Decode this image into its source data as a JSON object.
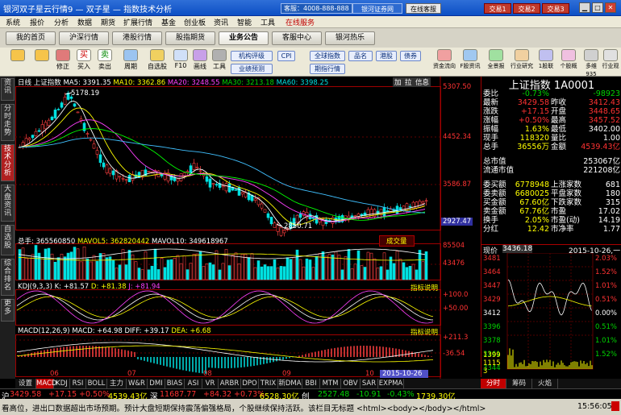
{
  "titlebar": {
    "app_title": "银河双子星云行情9 — 双子星 — 指数技术分析",
    "hotline": "客服：4008-888-888",
    "site_button": "银河证券网",
    "service_button": "在线客服",
    "trade_buttons": [
      "交易1",
      "交易2",
      "交易3"
    ]
  },
  "menu": [
    "系统",
    "报价",
    "分析",
    "数据",
    "期货",
    "扩展行情",
    "基金",
    "创业板",
    "资讯",
    "智能",
    "工具",
    "在线服务"
  ],
  "nav_tabs": [
    "我的首页",
    "沪深行情",
    "港股行情",
    "股指期货",
    "业务公告",
    "客服中心",
    "银河热乐"
  ],
  "toolbar": {
    "buttons": [
      "",
      "",
      "修正",
      "买入",
      "卖出",
      "周期",
      "自选股",
      "F10",
      "画线",
      "工具"
    ],
    "pills": [
      "机构评级",
      "业绩预测",
      "全球指数",
      "期指行情",
      "品名",
      "港股",
      "债券",
      "CPI"
    ],
    "right_buttons": [
      "资金流向",
      "F股资讯",
      "全景报",
      "行业研究",
      "1股联",
      "个股概",
      "多维935",
      "行业观"
    ]
  },
  "side_tabs": [
    "资讯",
    "分时走势",
    "技术分析",
    "大盘资讯",
    "自选股",
    "综合排名",
    "更多"
  ],
  "main_chart": {
    "price_header": [
      "日线",
      "上证指数",
      "MA5: 3391.35",
      "MA10: 3362.86",
      "MA20: 3248.55",
      "MA30: 3213.18",
      "MA60: 3398.25"
    ],
    "header_buttons": [
      "加",
      "拉",
      "信息"
    ],
    "high_label": "5178.19",
    "low_label": "2850.71",
    "price_axis": [
      "5307.50",
      "4452.34",
      "3586.87",
      "2927.47"
    ],
    "vol_header": [
      "总手: 365560850",
      "MAVOL5: 362820442",
      "MAVOL10: 349618967"
    ],
    "vol_button": "成交量",
    "vol_axis": [
      "85504",
      "43476"
    ],
    "kdj_header": [
      "KDJ(9,3,3)",
      "K: +81.57",
      "D: +81.38",
      "J: +81.94"
    ],
    "kdj_button": "指标说明",
    "kdj_axis": [
      "+100.0",
      "+50.00"
    ],
    "macd_header": [
      "MACD(12,26,9)",
      "MACD: +64.98",
      "DIFF: +39.17",
      "DEA: +6.68"
    ],
    "macd_button": "指标说明",
    "macd_axis": [
      "+211.3",
      "-36.54"
    ],
    "x_axis": [
      "06",
      "07",
      "08",
      "09",
      "10"
    ],
    "x_cursor_date": "2015-10-26"
  },
  "chart_data": {
    "type": "line",
    "title": "上证指数 日线",
    "x": [
      "06",
      "07",
      "08",
      "09",
      "10"
    ],
    "series": [
      {
        "name": "上证指数",
        "values": [
          4800,
          5178.19,
          3800,
          3950,
          3700,
          3200,
          2850.71,
          3100,
          3050,
          3250,
          3412.43
        ]
      }
    ],
    "ylim": [
      2927.47,
      5307.5
    ]
  },
  "right_panel": {
    "title": "上证指数 1A0001",
    "rows": [
      {
        "l1": "委比",
        "v1": "-0.73%",
        "l2": "",
        "v2": "-98923"
      },
      {
        "l1": "最新",
        "v1": "3429.58",
        "l2": "昨收",
        "v2": "3412.43"
      },
      {
        "l1": "涨跌",
        "v1": "+17.15",
        "l2": "开盘",
        "v2": "3448.65"
      },
      {
        "l1": "涨幅",
        "v1": "+0.50%",
        "l2": "最高",
        "v2": "3457.52"
      },
      {
        "l1": "振幅",
        "v1": "1.63%",
        "l2": "最低",
        "v2": "3402.00"
      },
      {
        "l1": "现手",
        "v1": "118320",
        "l2": "量比",
        "v2": "1.00"
      },
      {
        "l1": "总手",
        "v1": "36556万",
        "l2": "金额",
        "v2": "4539.43亿"
      },
      {
        "l1": "总市值",
        "v1": "",
        "l2": "",
        "v2": "253067亿"
      },
      {
        "l1": "流通市值",
        "v1": "",
        "l2": "",
        "v2": "221208亿"
      },
      {
        "l1": "委买额",
        "v1": "6778948",
        "l2": "上涨家数",
        "v2": "681"
      },
      {
        "l1": "委卖额",
        "v1": "6680025",
        "l2": "平盘家数",
        "v2": "180"
      },
      {
        "l1": "买金额",
        "v1": "67.60亿",
        "l2": "下跌家数",
        "v2": "315"
      },
      {
        "l1": "卖金额",
        "v1": "67.76亿",
        "l2": "市盈",
        "v2": "17.02"
      },
      {
        "l1": "换手",
        "v1": "2.05%",
        "l2": "市盈(动)",
        "v2": "14.19"
      },
      {
        "l1": "分红",
        "v1": "12.42",
        "l2": "市净率",
        "v2": "1.77"
      }
    ],
    "mini_header_left": "现价",
    "mini_header_price": "3436.18",
    "mini_header_date": "2015-10-26,一",
    "mini_price_axis": [
      "3481",
      "3464",
      "3447",
      "3429",
      "3412",
      "3396",
      "3378",
      "3361",
      "3344"
    ],
    "mini_pct_axis": [
      "2.03%",
      "1.52%",
      "1.01%",
      "0.51%",
      "0.00%",
      "0.51%",
      "1.01%",
      "1.52%"
    ],
    "mini_vol_axis": [
      "1399",
      "1115",
      "3"
    ],
    "mini_tabs": [
      "分时",
      "筹码",
      "火焰"
    ]
  },
  "bottom_tabs": [
    "设置",
    "MACD",
    "KDJ",
    "RSI",
    "BOLL",
    "主力",
    "W&R",
    "DMI",
    "BIAS",
    "ASI",
    "VR",
    "ARBR",
    "DPO",
    "TRIX",
    "新DMA",
    "BBI",
    "MTM",
    "OBV",
    "SAR",
    "EXPMA"
  ],
  "ticker": {
    "sh_label": "沪",
    "sh_price": "3429.58",
    "sh_change": "+17.15",
    "sh_pct": "+0.50%",
    "sh_amount": "4539.43亿",
    "sz_label": "深",
    "sz_price": "11687.77",
    "sz_change": "+84.32",
    "sz_pct": "+0.73%",
    "sz_amount": "6528.30亿",
    "cy_label": "创",
    "cy_price": "2527.48",
    "cy_change": "-10.91",
    "cy_pct": "-0.43%",
    "cy_amount": "1739.30亿",
    "news": "看高位，进出口数据超出市场预期。预计大盘短期保持震荡偏强格局，个股继续保持活跃。该栏目无标题 <html><body></body></html>",
    "time": "15:56:05"
  }
}
